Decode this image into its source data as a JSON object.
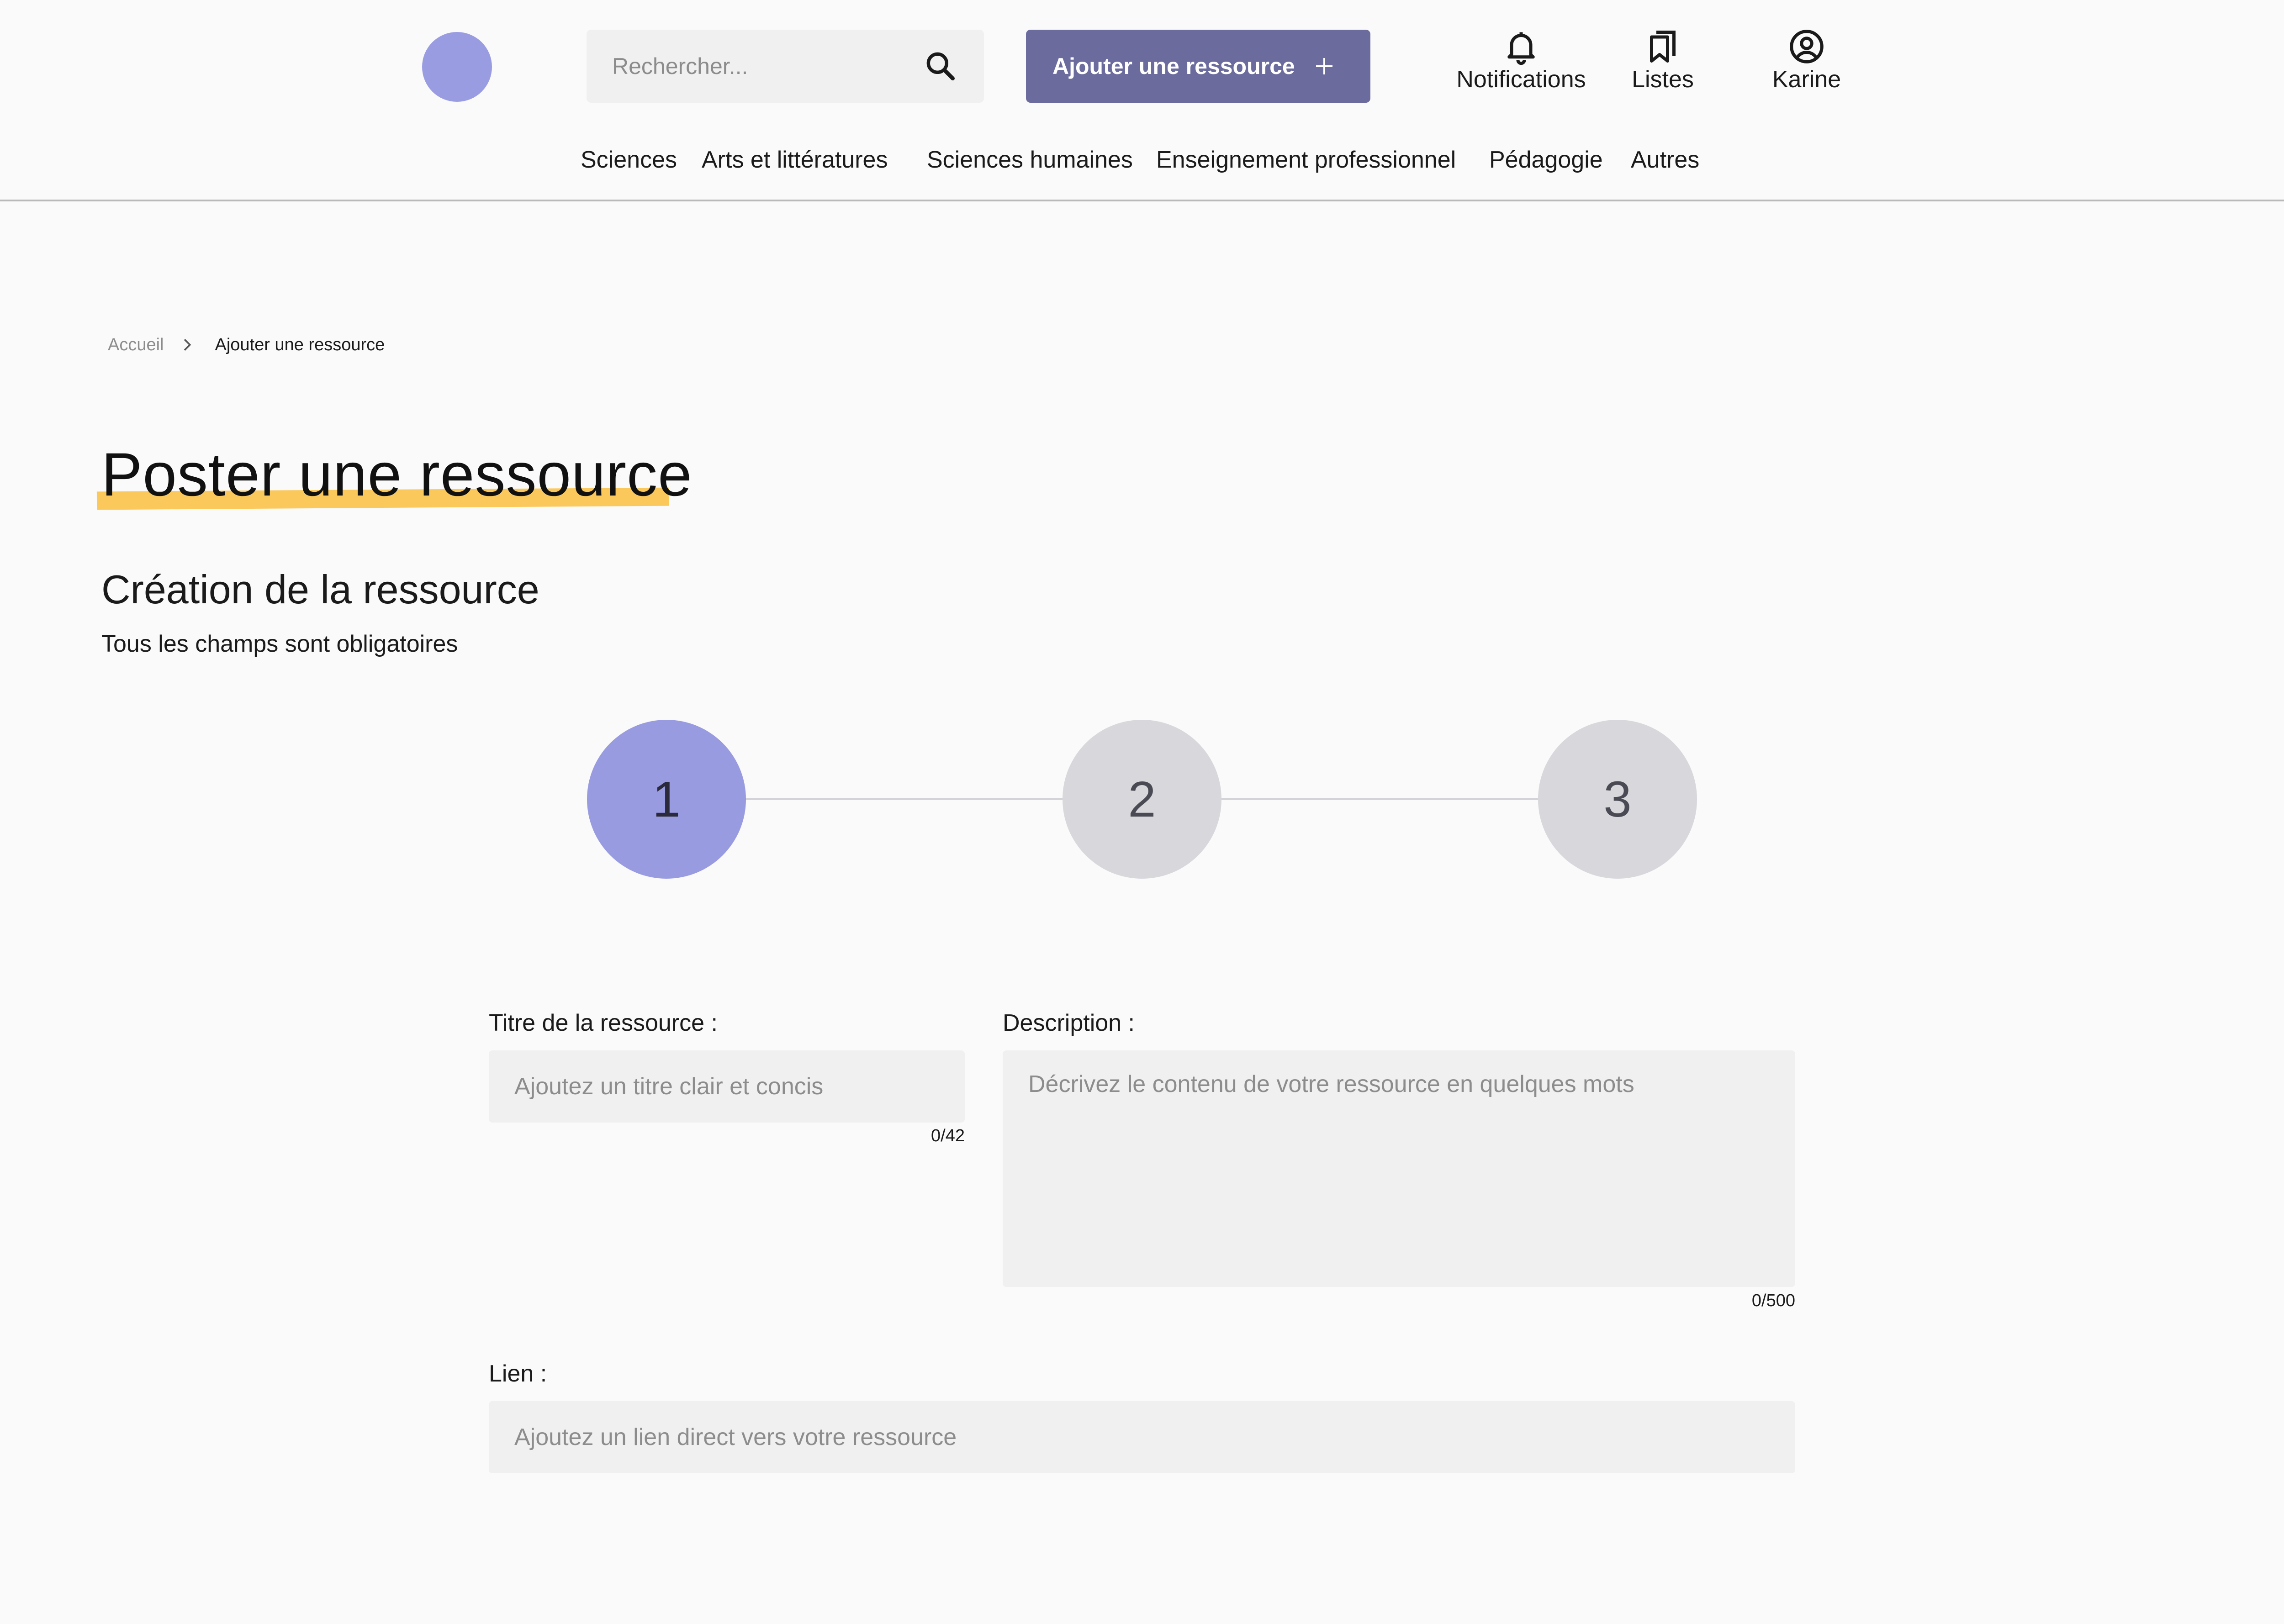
{
  "header": {
    "search_placeholder": "Rechercher...",
    "add_button_label": "Ajouter une ressource",
    "notifications_label": "Notifications",
    "lists_label": "Listes",
    "user_label": "Karine"
  },
  "nav": {
    "items": [
      "Sciences",
      "Arts et littératures",
      "Sciences humaines",
      "Enseignement professionnel",
      "Pédagogie",
      "Autres"
    ]
  },
  "breadcrumb": {
    "home": "Accueil",
    "current": "Ajouter une ressource"
  },
  "page": {
    "title": "Poster une ressource",
    "section_title": "Création de la ressource",
    "section_subtitle": "Tous les champs sont obligatoires"
  },
  "stepper": {
    "steps": [
      "1",
      "2",
      "3"
    ],
    "active_step": 1
  },
  "form": {
    "title_label": "Titre de la ressource :",
    "title_placeholder": "Ajoutez un titre clair et concis",
    "title_counter": "0/42",
    "description_label": "Description :",
    "description_placeholder": "Décrivez le contenu de votre ressource en quelques mots",
    "description_counter": "0/500",
    "link_label": "Lien :",
    "link_placeholder": "Ajoutez un lien direct vers votre ressource"
  },
  "colors": {
    "accent": "#9a9ce2",
    "button": "#6b6b9e",
    "highlight": "#fbc85b",
    "step_inactive": "#d7d7dc",
    "field_bg": "#f0f0f0"
  }
}
